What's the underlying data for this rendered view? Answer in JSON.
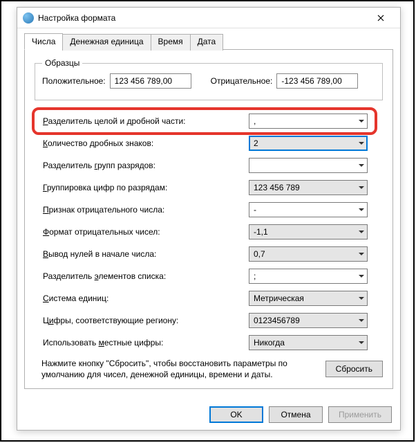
{
  "window": {
    "title": "Настройка формата"
  },
  "tabs": {
    "numbers": "Числа",
    "currency": "Денежная единица",
    "time": "Время",
    "date": "Дата"
  },
  "samples": {
    "legend": "Образцы",
    "positive_label": "Положительное:",
    "positive_value": "123 456 789,00",
    "negative_label": "Отрицательное:",
    "negative_value": "-123 456 789,00"
  },
  "rows": {
    "decimal_sep": {
      "label_pre": "",
      "label_u": "Р",
      "label_post": "азделитель целой и дробной части:",
      "value": ","
    },
    "decimal_digits": {
      "label_pre": "",
      "label_u": "К",
      "label_post": "оличество дробных знаков:",
      "value": "2"
    },
    "group_sep": {
      "label_pre": "Разделитель ",
      "label_u": "г",
      "label_post": "рупп разрядов:",
      "value": " "
    },
    "grouping": {
      "label_pre": "",
      "label_u": "Г",
      "label_post": "руппировка цифр по разрядам:",
      "value": "123 456 789"
    },
    "neg_sign": {
      "label_pre": "",
      "label_u": "П",
      "label_post": "ризнак отрицательного числа:",
      "value": "-"
    },
    "neg_format": {
      "label_pre": "",
      "label_u": "Ф",
      "label_post": "ормат отрицательных чисел:",
      "value": "-1,1"
    },
    "leading_zero": {
      "label_pre": "",
      "label_u": "В",
      "label_post": "ывод нулей в начале числа:",
      "value": "0,7"
    },
    "list_sep": {
      "label_pre": "Разделитель ",
      "label_u": "э",
      "label_post": "лементов списка:",
      "value": ";"
    },
    "measure": {
      "label_pre": "",
      "label_u": "С",
      "label_post": "истема единиц:",
      "value": "Метрическая"
    },
    "native_digits": {
      "label_pre": "Ц",
      "label_u": "и",
      "label_post": "фры, соответствующие региону:",
      "value": "0123456789"
    },
    "use_native": {
      "label_pre": "Использовать ",
      "label_u": "м",
      "label_post": "естные цифры:",
      "value": "Никогда"
    }
  },
  "reset": {
    "text": "Нажмите кнопку \"Сбросить\", чтобы восстановить параметры по умолчанию для чисел, денежной единицы, времени и даты.",
    "button": "Сбросить"
  },
  "footer": {
    "ok": "OK",
    "cancel": "Отмена",
    "apply": "Применить"
  }
}
